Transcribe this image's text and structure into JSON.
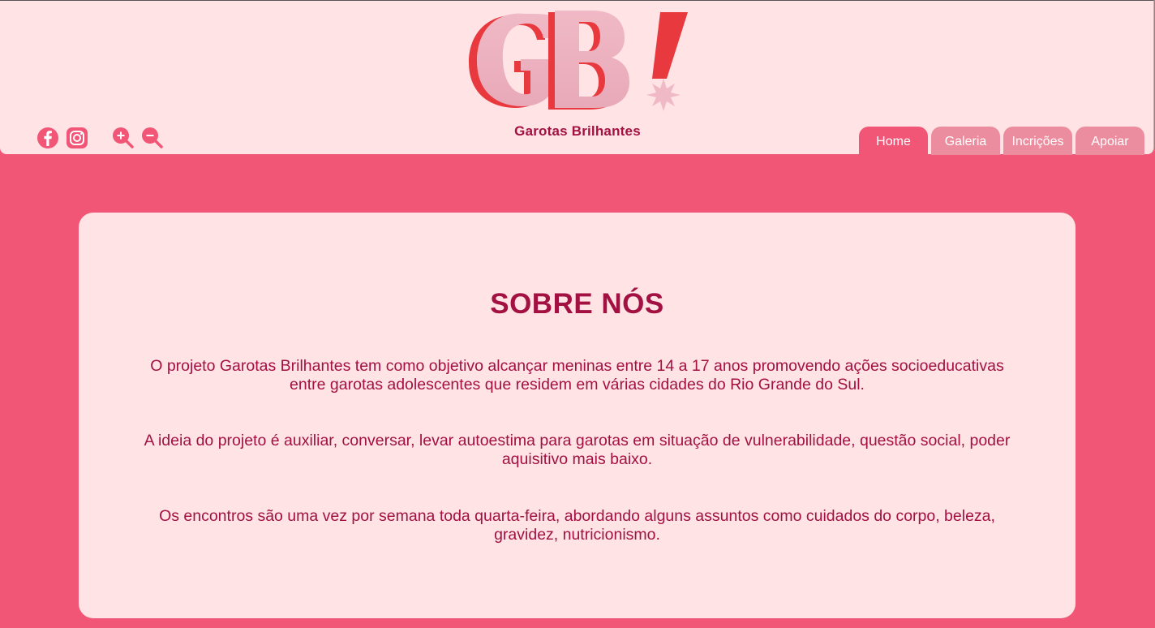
{
  "header": {
    "logo_text": "GB!",
    "brand_name": "Garotas Brilhantes",
    "social": [
      {
        "name": "facebook-icon",
        "label": "Facebook"
      },
      {
        "name": "instagram-icon",
        "label": "Instagram"
      }
    ],
    "zoom": [
      {
        "name": "zoom-in-icon",
        "label": "Aumentar"
      },
      {
        "name": "zoom-out-icon",
        "label": "Diminuir"
      }
    ]
  },
  "nav": {
    "tabs": [
      {
        "label": "Home",
        "active": true
      },
      {
        "label": "Galeria",
        "active": false
      },
      {
        "label": "Incrições",
        "active": false
      },
      {
        "label": "Apoiar",
        "active": false
      }
    ]
  },
  "about": {
    "title": "SOBRE NÓS",
    "paragraphs": [
      "O projeto Garotas Brilhantes tem como objetivo alcançar meninas entre 14 a 17 anos promovendo ações socioeducativas entre garotas adolescentes que residem em várias cidades do Rio Grande do Sul.",
      "A ideia do projeto é auxiliar, conversar, levar autoestima para garotas em situação de vulnerabilidade, questão social, poder aquisitivo mais baixo.",
      "Os encontros são uma vez por semana toda quarta-feira, abordando alguns assuntos como cuidados do corpo, beleza, gravidez, nutricionismo."
    ]
  },
  "colors": {
    "page_background": "#f15677",
    "header_background": "#ffe3e5",
    "text_primary": "#a31042",
    "tab_active": "#f15677",
    "tab_inactive": "#ec8d9f",
    "icon_pink": "#f15677"
  }
}
